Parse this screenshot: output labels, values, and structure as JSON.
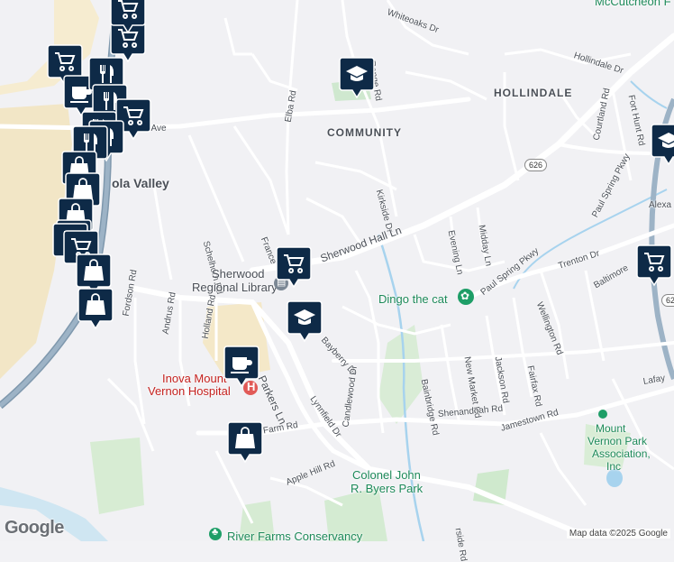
{
  "map": {
    "roads": [
      "Whiteoaks Dr",
      "Range Rd",
      "Hollindale Dr",
      "Fort Hunt Rd",
      "Elba Rd",
      "well Ave",
      "Courtland Rd",
      "Kirkside Dr",
      "Paul Spring Pkwy",
      "Schelhorn Rd",
      "France",
      "Sherwood Hall Ln",
      "Midday Ln",
      "Evening Ln",
      "Trenton Dr",
      "Baltimore",
      "Fordson Rd",
      "Andrus Rd",
      "Holland Rd",
      "Parkers Ln",
      "Bayberry Dr",
      "Paul Spring Pkwy",
      "Wellington Rd",
      "Jackson Rd",
      "New Market Rd",
      "Bainbridge Rd",
      "Fairfax Rd",
      "Candlewood Dr",
      "Lynnfield Dr",
      "Shenandoah Rd",
      "Jamestown Rd",
      "h Farm Rd",
      "Apple Hill Rd",
      "rside Rd",
      "Lafay",
      "Alexa"
    ],
    "areas": [
      "HOLLINDALE",
      "COMMUNITY"
    ],
    "places": [
      "ola Valley",
      "Sherwood",
      "Regional Library",
      "Inova Mount",
      "Vernon Hospital",
      "Dingo the cat",
      "Mount",
      "Vernon Park",
      "Association,",
      "Inc",
      "Colonel John",
      "R. Byers Park",
      "River Farms Conservancy",
      "McCutcheon F"
    ],
    "shields": [
      "626",
      "62"
    ],
    "google": "Google",
    "attribution": "Map data ©2025 Google"
  }
}
